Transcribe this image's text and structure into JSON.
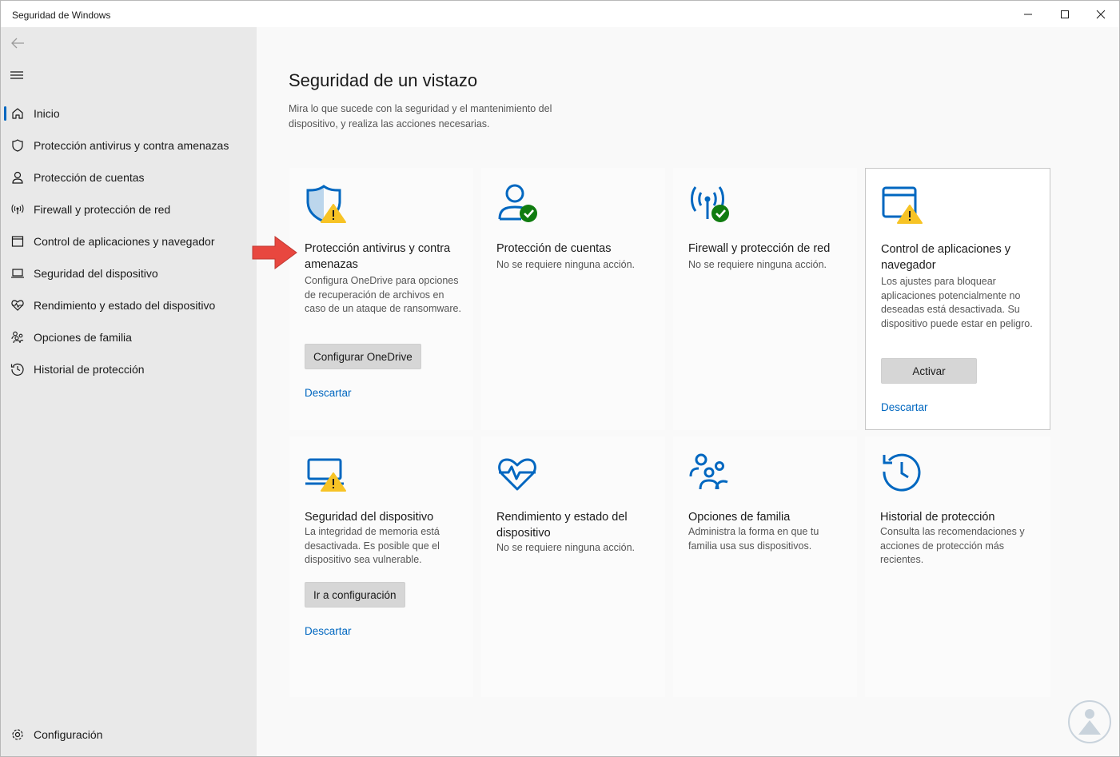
{
  "window": {
    "title": "Seguridad de Windows"
  },
  "sidebar": {
    "items": [
      {
        "label": "Inicio",
        "icon": "home-icon"
      },
      {
        "label": "Protección antivirus y contra amenazas",
        "icon": "shield-icon"
      },
      {
        "label": "Protección de cuentas",
        "icon": "person-icon"
      },
      {
        "label": "Firewall y protección de red",
        "icon": "wifi-antenna-icon"
      },
      {
        "label": "Control de aplicaciones y navegador",
        "icon": "app-window-icon"
      },
      {
        "label": "Seguridad del dispositivo",
        "icon": "laptop-icon"
      },
      {
        "label": "Rendimiento y estado del dispositivo",
        "icon": "heart-pulse-icon"
      },
      {
        "label": "Opciones de familia",
        "icon": "family-icon"
      },
      {
        "label": "Historial de protección",
        "icon": "history-icon"
      }
    ],
    "settings": {
      "label": "Configuración",
      "icon": "gear-icon"
    }
  },
  "main": {
    "title": "Seguridad de un vistazo",
    "subtitle": "Mira lo que sucede con la seguridad y el mantenimiento del dispositivo, y realiza las acciones necesarias."
  },
  "cards": {
    "antivirus": {
      "title": "Protección antivirus y contra amenazas",
      "desc": "Configura OneDrive para opciones de recuperación de archivos en caso de un ataque de ransomware.",
      "button": "Configurar OneDrive",
      "link": "Descartar",
      "status": "warning"
    },
    "accounts": {
      "title": "Protección de cuentas",
      "desc": "No se requiere ninguna acción.",
      "status": "ok"
    },
    "firewall": {
      "title": "Firewall y protección de red",
      "desc": "No se requiere ninguna acción.",
      "status": "ok"
    },
    "appcontrol": {
      "title": "Control de aplicaciones y navegador",
      "desc": "Los ajustes para bloquear aplicaciones potencialmente no deseadas está desactivada. Su dispositivo puede estar en peligro.",
      "button": "Activar",
      "link": "Descartar",
      "status": "warning"
    },
    "device": {
      "title": "Seguridad del dispositivo",
      "desc": "La integridad de memoria está desactivada. Es posible que el dispositivo sea vulnerable.",
      "button": "Ir a configuración",
      "link": "Descartar",
      "status": "warning"
    },
    "performance": {
      "title": "Rendimiento y estado del dispositivo",
      "desc": "No se requiere ninguna acción."
    },
    "family": {
      "title": "Opciones de familia",
      "desc": "Administra la forma en que tu familia usa sus dispositivos."
    },
    "history": {
      "title": "Historial de protección",
      "desc": "Consulta las recomendaciones y acciones de protección más recientes."
    }
  },
  "colors": {
    "accent": "#0067c0",
    "warning": "#f7c325",
    "ok": "#107c10",
    "arrow": "#e8473f"
  }
}
